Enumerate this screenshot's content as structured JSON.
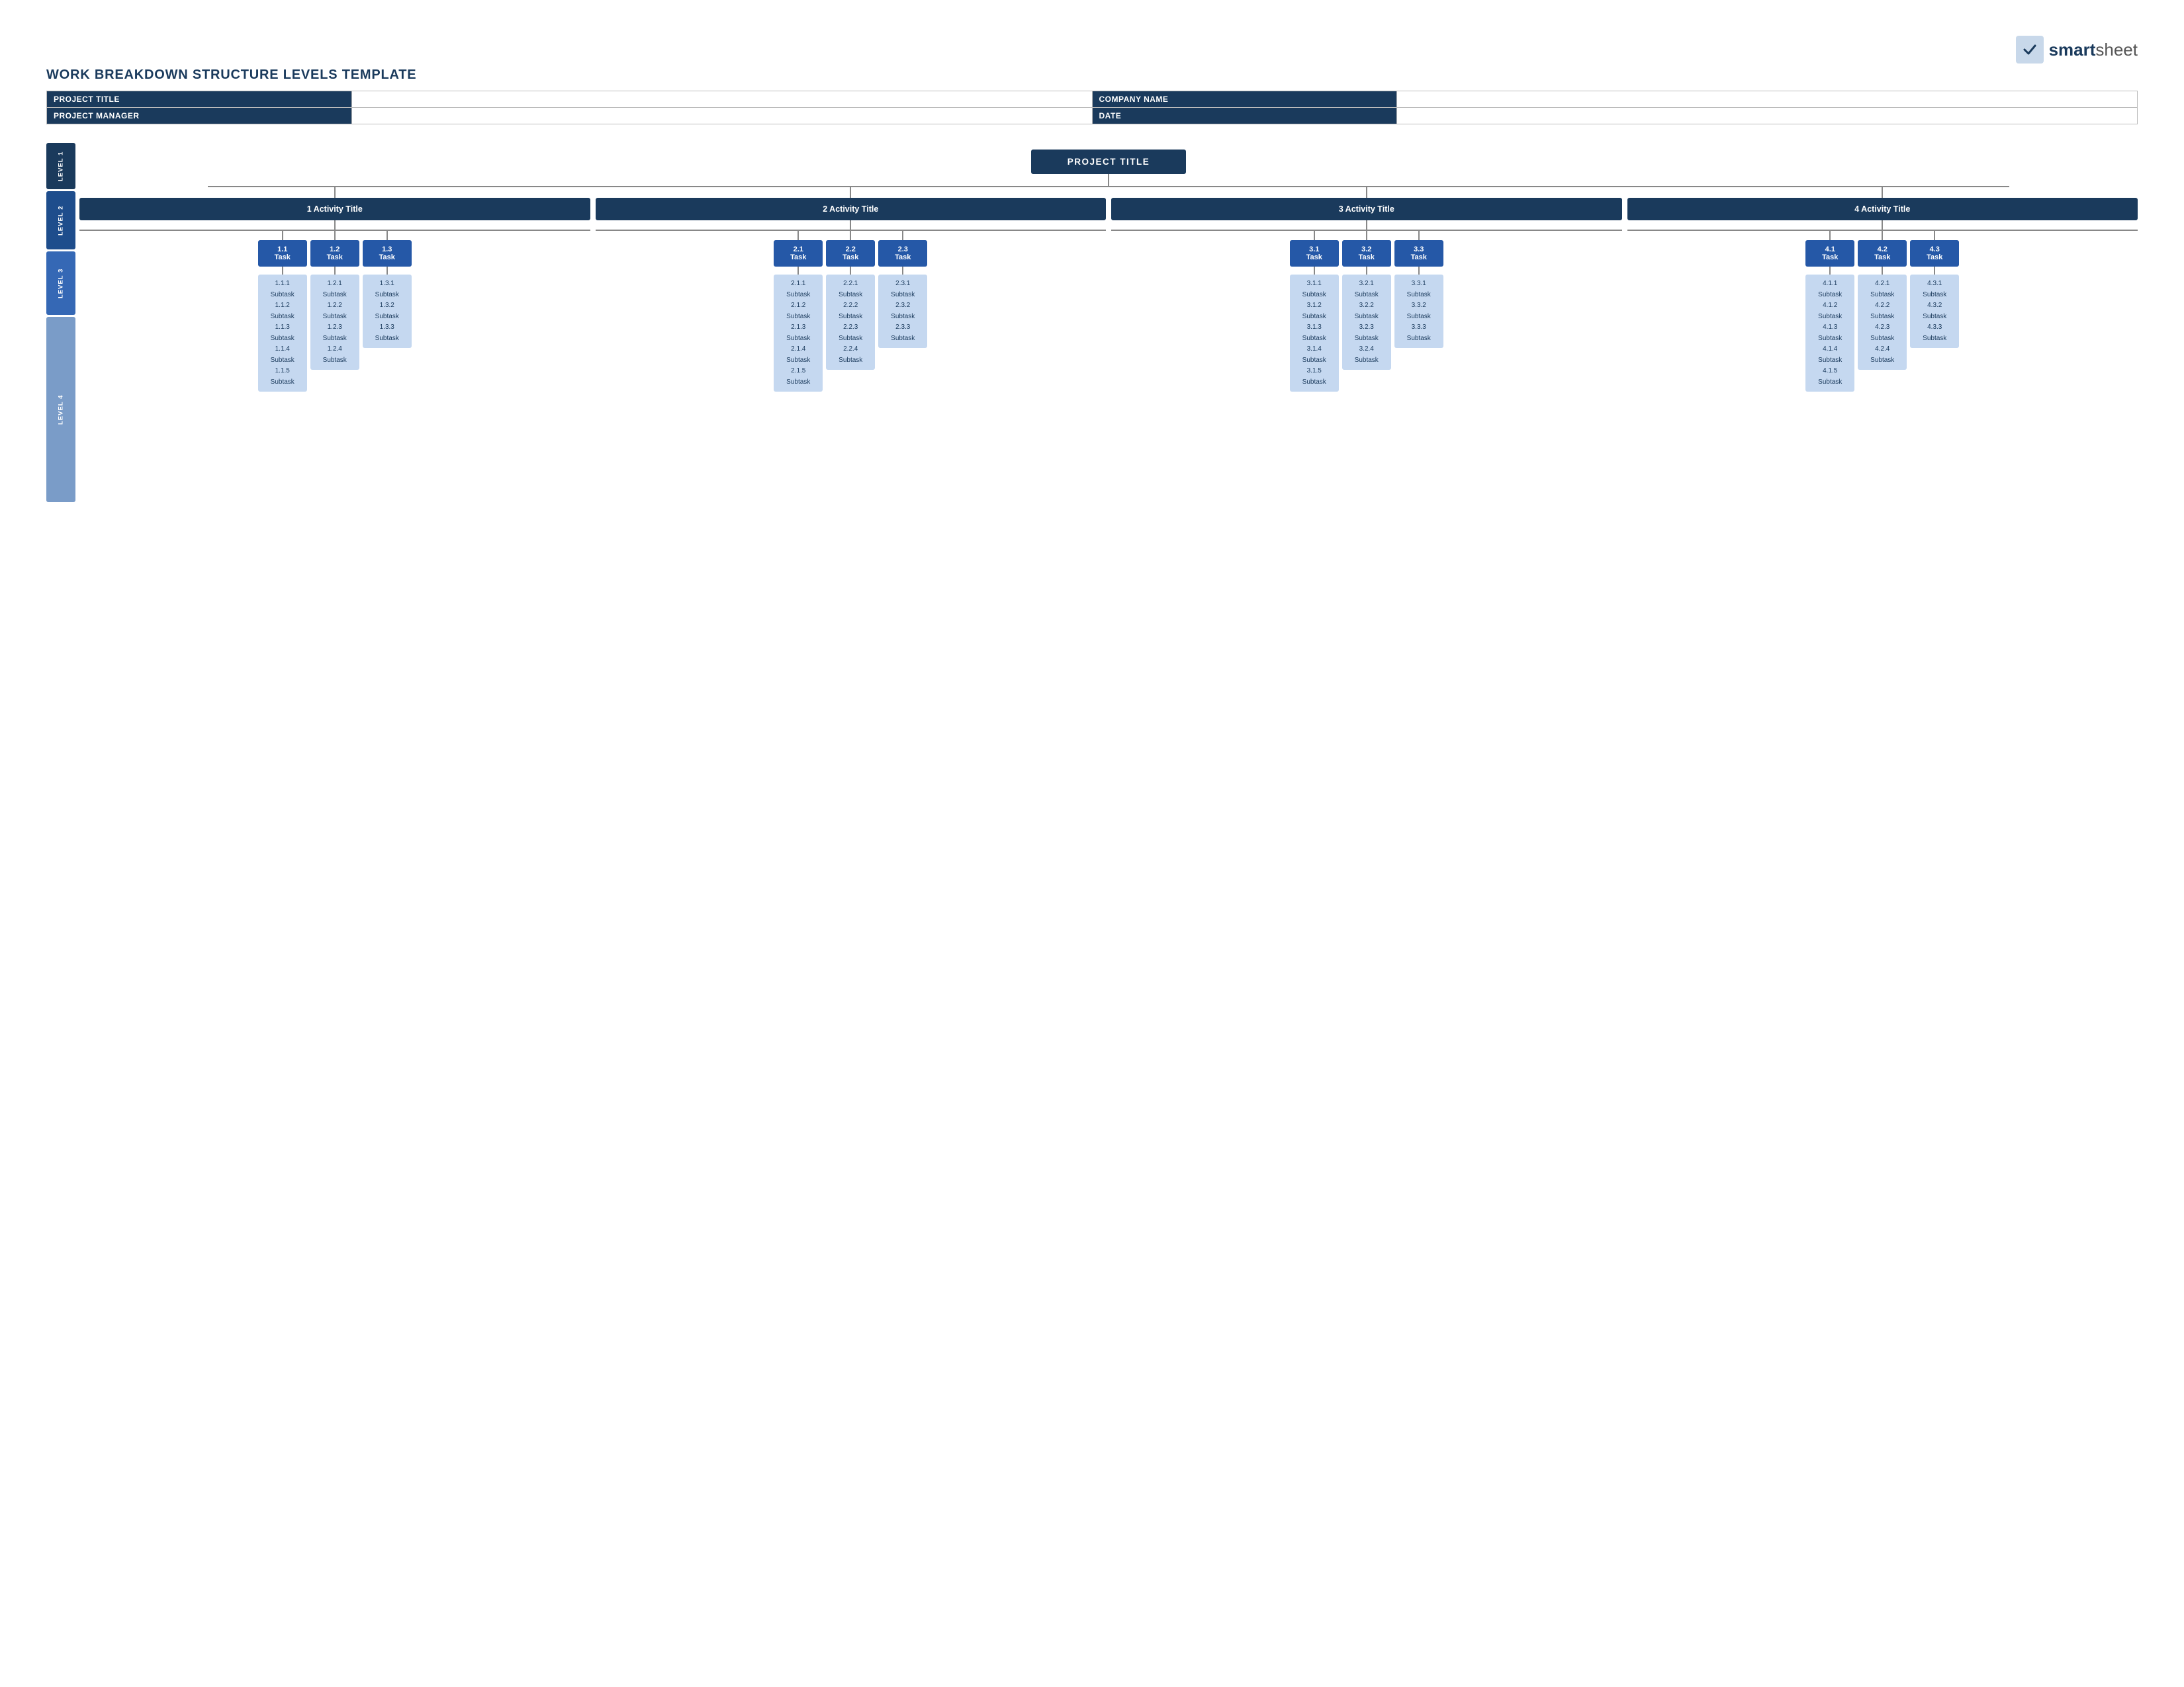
{
  "logo": {
    "bold": "smart",
    "light": "sheet",
    "icon_alt": "smartsheet checkmark"
  },
  "page_title": "WORK BREAKDOWN STRUCTURE LEVELS TEMPLATE",
  "meta": {
    "rows": [
      {
        "label": "PROJECT TITLE",
        "label2": "COMPANY NAME"
      },
      {
        "label": "PROJECT MANAGER",
        "label2": "DATE"
      }
    ]
  },
  "sidebar": {
    "levels": [
      "LEVEL 1",
      "LEVEL 2",
      "LEVEL 3",
      "LEVEL 4"
    ]
  },
  "project": {
    "title": "PROJECT TITLE"
  },
  "activities": [
    {
      "id": "act1",
      "label": "1 Activity Title",
      "tasks": [
        {
          "id": "t11",
          "label": "1.1\nTask",
          "subtasks": [
            "1.1.1\nSubtask",
            "1.1.2\nSubtask",
            "1.1.3\nSubtask",
            "1.1.4\nSubtask",
            "1.1.5\nSubtask"
          ]
        },
        {
          "id": "t12",
          "label": "1.2\nTask",
          "subtasks": [
            "1.2.1\nSubtask",
            "1.2.2\nSubtask",
            "1.2.3\nSubtask",
            "1.2.4\nSubtask"
          ]
        },
        {
          "id": "t13",
          "label": "1.3\nTask",
          "subtasks": [
            "1.3.1\nSubtask",
            "1.3.2\nSubtask",
            "1.3.3\nSubtask"
          ]
        }
      ]
    },
    {
      "id": "act2",
      "label": "2 Activity Title",
      "tasks": [
        {
          "id": "t21",
          "label": "2.1\nTask",
          "subtasks": [
            "2.1.1\nSubtask",
            "2.1.2\nSubtask",
            "2.1.3\nSubtask",
            "2.1.4\nSubtask",
            "2.1.5\nSubtask"
          ]
        },
        {
          "id": "t22",
          "label": "2.2\nTask",
          "subtasks": [
            "2.2.1\nSubtask",
            "2.2.2\nSubtask",
            "2.2.3\nSubtask",
            "2.2.4\nSubtask"
          ]
        },
        {
          "id": "t23",
          "label": "2.3\nTask",
          "subtasks": [
            "2.3.1\nSubtask",
            "2.3.2\nSubtask",
            "2.3.3\nSubtask"
          ]
        }
      ]
    },
    {
      "id": "act3",
      "label": "3 Activity Title",
      "tasks": [
        {
          "id": "t31",
          "label": "3.1\nTask",
          "subtasks": [
            "3.1.1\nSubtask",
            "3.1.2\nSubtask",
            "3.1.3\nSubtask",
            "3.1.4\nSubtask",
            "3.1.5\nSubtask"
          ]
        },
        {
          "id": "t32",
          "label": "3.2\nTask",
          "subtasks": [
            "3.2.1\nSubtask",
            "3.2.2\nSubtask",
            "3.2.3\nSubtask",
            "3.2.4\nSubtask"
          ]
        },
        {
          "id": "t33",
          "label": "3.3\nTask",
          "subtasks": [
            "3.3.1\nSubtask",
            "3.3.2\nSubtask",
            "3.3.3\nSubtask"
          ]
        }
      ]
    },
    {
      "id": "act4",
      "label": "4 Activity Title",
      "tasks": [
        {
          "id": "t41",
          "label": "4.1\nTask",
          "subtasks": [
            "4.1.1\nSubtask",
            "4.1.2\nSubtask",
            "4.1.3\nSubtask",
            "4.1.4\nSubtask",
            "4.1.5\nSubtask"
          ]
        },
        {
          "id": "t42",
          "label": "4.2\nTask",
          "subtasks": [
            "4.2.1\nSubtask",
            "4.2.2\nSubtask",
            "4.2.3\nSubtask",
            "4.2.4\nSubtask"
          ]
        },
        {
          "id": "t43",
          "label": "4.3\nTask",
          "subtasks": [
            "4.3.1\nSubtask",
            "4.3.2\nSubtask",
            "4.3.3\nSubtask"
          ]
        }
      ]
    }
  ]
}
